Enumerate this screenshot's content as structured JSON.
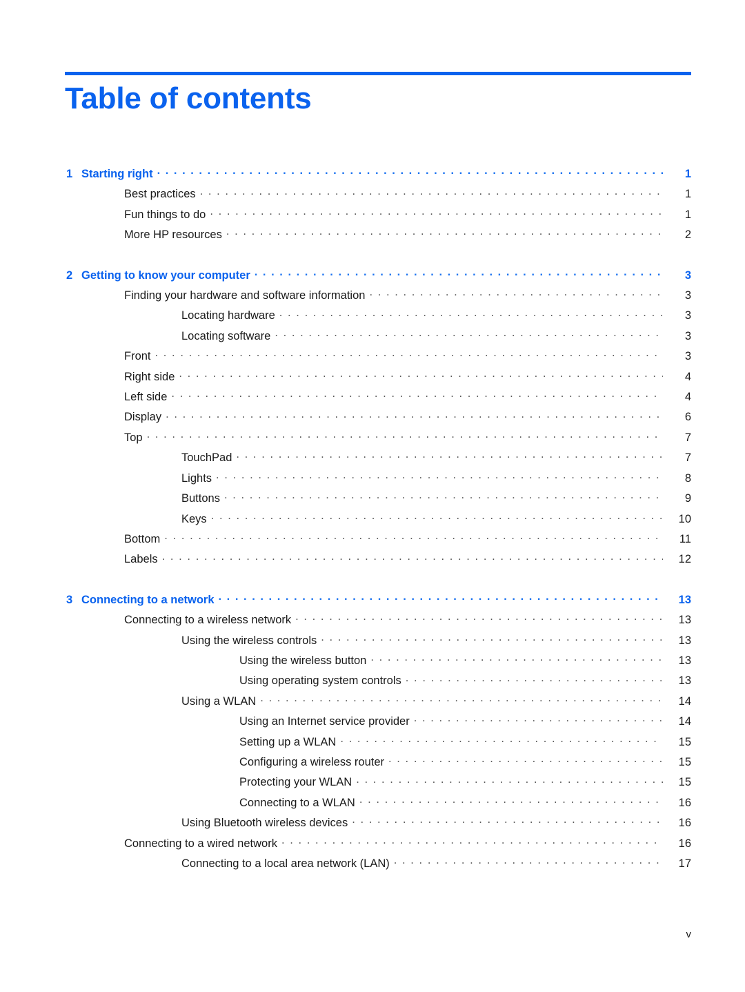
{
  "document": {
    "title": "Table of contents",
    "accent_color": "#0A62EE",
    "text_color": "#1a1a1a",
    "footer_page_label": "v"
  },
  "toc": {
    "chapters": [
      {
        "number": "1",
        "title": "Starting right",
        "page": "1",
        "entries": [
          {
            "level": 2,
            "label": "Best practices",
            "page": "1"
          },
          {
            "level": 2,
            "label": "Fun things to do",
            "page": "1"
          },
          {
            "level": 2,
            "label": "More HP resources",
            "page": "2"
          }
        ]
      },
      {
        "number": "2",
        "title": "Getting to know your computer",
        "page": "3",
        "entries": [
          {
            "level": 2,
            "label": "Finding your hardware and software information",
            "page": "3"
          },
          {
            "level": 3,
            "label": "Locating hardware",
            "page": "3"
          },
          {
            "level": 3,
            "label": "Locating software",
            "page": "3"
          },
          {
            "level": 2,
            "label": "Front",
            "page": "3"
          },
          {
            "level": 2,
            "label": "Right side",
            "page": "4"
          },
          {
            "level": 2,
            "label": "Left side",
            "page": "4"
          },
          {
            "level": 2,
            "label": "Display",
            "page": "6"
          },
          {
            "level": 2,
            "label": "Top",
            "page": "7"
          },
          {
            "level": 3,
            "label": "TouchPad",
            "page": "7"
          },
          {
            "level": 3,
            "label": "Lights",
            "page": "8"
          },
          {
            "level": 3,
            "label": "Buttons",
            "page": "9"
          },
          {
            "level": 3,
            "label": "Keys",
            "page": "10"
          },
          {
            "level": 2,
            "label": "Bottom",
            "page": "11"
          },
          {
            "level": 2,
            "label": "Labels",
            "page": "12"
          }
        ]
      },
      {
        "number": "3",
        "title": "Connecting to a network",
        "page": "13",
        "entries": [
          {
            "level": 2,
            "label": "Connecting to a wireless network",
            "page": "13"
          },
          {
            "level": 3,
            "label": "Using the wireless controls",
            "page": "13"
          },
          {
            "level": 4,
            "label": "Using the wireless button",
            "page": "13"
          },
          {
            "level": 4,
            "label": "Using operating system controls",
            "page": "13"
          },
          {
            "level": 3,
            "label": "Using a WLAN",
            "page": "14"
          },
          {
            "level": 4,
            "label": "Using an Internet service provider",
            "page": "14"
          },
          {
            "level": 4,
            "label": "Setting up a WLAN",
            "page": "15"
          },
          {
            "level": 4,
            "label": "Configuring a wireless router",
            "page": "15"
          },
          {
            "level": 4,
            "label": "Protecting your WLAN",
            "page": "15"
          },
          {
            "level": 4,
            "label": "Connecting to a WLAN",
            "page": "16"
          },
          {
            "level": 3,
            "label": "Using Bluetooth wireless devices",
            "page": "16"
          },
          {
            "level": 2,
            "label": "Connecting to a wired network",
            "page": "16"
          },
          {
            "level": 3,
            "label": "Connecting to a local area network (LAN)",
            "page": "17"
          }
        ]
      }
    ]
  }
}
